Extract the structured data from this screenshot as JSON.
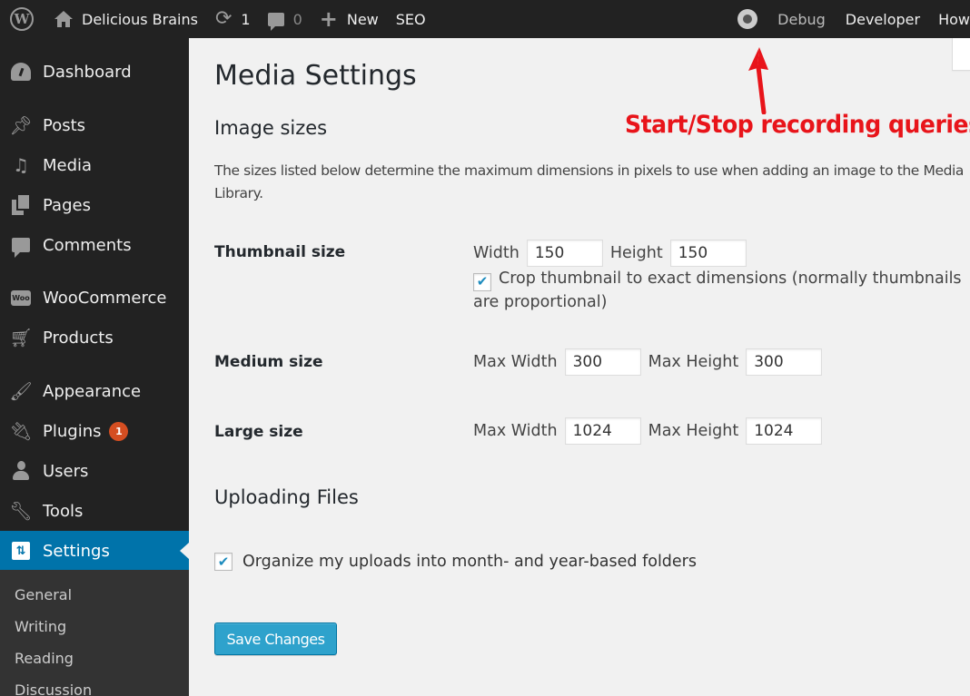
{
  "adminbar": {
    "wp_logo_icon": "wordpress-logo-icon",
    "site_name": "Delicious Brains",
    "updates_count": "1",
    "comments_count": "0",
    "new_label": "New",
    "seo_label": "SEO",
    "record_icon": "record-toggle-icon",
    "debug_label": "Debug",
    "developer_label": "Developer",
    "howdy_label": "How"
  },
  "sidebar": {
    "items": [
      {
        "label": "Dashboard",
        "icon": "dashboard-icon"
      },
      {
        "label": "Posts",
        "icon": "pushpin-icon"
      },
      {
        "label": "Media",
        "icon": "media-icon"
      },
      {
        "label": "Pages",
        "icon": "pages-icon"
      },
      {
        "label": "Comments",
        "icon": "comment-icon"
      },
      {
        "label": "WooCommerce",
        "icon": "woocommerce-icon"
      },
      {
        "label": "Products",
        "icon": "cart-icon"
      },
      {
        "label": "Appearance",
        "icon": "paintbrush-icon"
      },
      {
        "label": "Plugins",
        "icon": "plugin-icon",
        "badge": "1"
      },
      {
        "label": "Users",
        "icon": "user-icon"
      },
      {
        "label": "Tools",
        "icon": "wrench-icon"
      },
      {
        "label": "Settings",
        "icon": "settings-icon",
        "current": true
      }
    ],
    "submenu": [
      "General",
      "Writing",
      "Reading",
      "Discussion"
    ],
    "colors": {
      "current_bg": "#0073aa",
      "badge_bg": "#d54e21"
    }
  },
  "main": {
    "page_title": "Media Settings",
    "image_sizes_heading": "Image sizes",
    "description": "The sizes listed below determine the maximum dimensions in pixels to use when adding an image to the Media Library.",
    "thumbnail": {
      "label": "Thumbnail size",
      "width_label": "Width",
      "width_value": "150",
      "height_label": "Height",
      "height_value": "150",
      "crop_checked": true,
      "crop_label": "Crop thumbnail to exact dimensions (normally thumbnails are proportional)"
    },
    "medium": {
      "label": "Medium size",
      "max_width_label": "Max Width",
      "max_width_value": "300",
      "max_height_label": "Max Height",
      "max_height_value": "300"
    },
    "large": {
      "label": "Large size",
      "max_width_label": "Max Width",
      "max_width_value": "1024",
      "max_height_label": "Max Height",
      "max_height_value": "1024"
    },
    "uploading_heading": "Uploading Files",
    "organize_checked": true,
    "organize_label": "Organize my uploads into month- and year-based folders",
    "save_label": "Save Changes",
    "colors": {
      "button_bg": "#2ea2cc",
      "checkmark": "#1e8cbe"
    }
  },
  "annotation": {
    "text": "Start/Stop recording queries",
    "color": "#e8141a"
  }
}
